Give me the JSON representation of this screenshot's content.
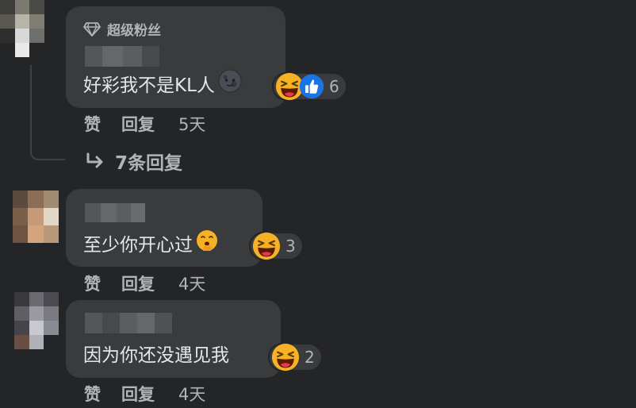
{
  "comments": [
    {
      "badge": "超级粉丝",
      "text": "好彩我不是KL人",
      "reaction_count": "6",
      "actions": {
        "like": "赞",
        "reply": "回复",
        "time": "5天"
      }
    },
    {
      "text": "至少你开心过",
      "reaction_count": "3",
      "actions": {
        "like": "赞",
        "reply": "回复",
        "time": "4天"
      }
    },
    {
      "text": "因为你还没遇见我",
      "reaction_count": "2",
      "actions": {
        "like": "赞",
        "reply": "回复",
        "time": "4天"
      }
    }
  ],
  "replies_link": "7条回复",
  "icons": {
    "badge": "diamond-icon",
    "reply_arrow": "reply-arrow-icon",
    "haha": "haha-reaction-icon",
    "like": "like-reaction-icon",
    "moon": "new-moon-face-icon",
    "shush": "face-with-hand-over-mouth-icon"
  },
  "colors": {
    "background": "#242526",
    "bubble": "#3a3b3c",
    "primary_text": "#e4e6eb",
    "secondary_text": "#b0b3b8",
    "like_blue": "#1b74e4",
    "haha_yellow": "#f7b125"
  }
}
